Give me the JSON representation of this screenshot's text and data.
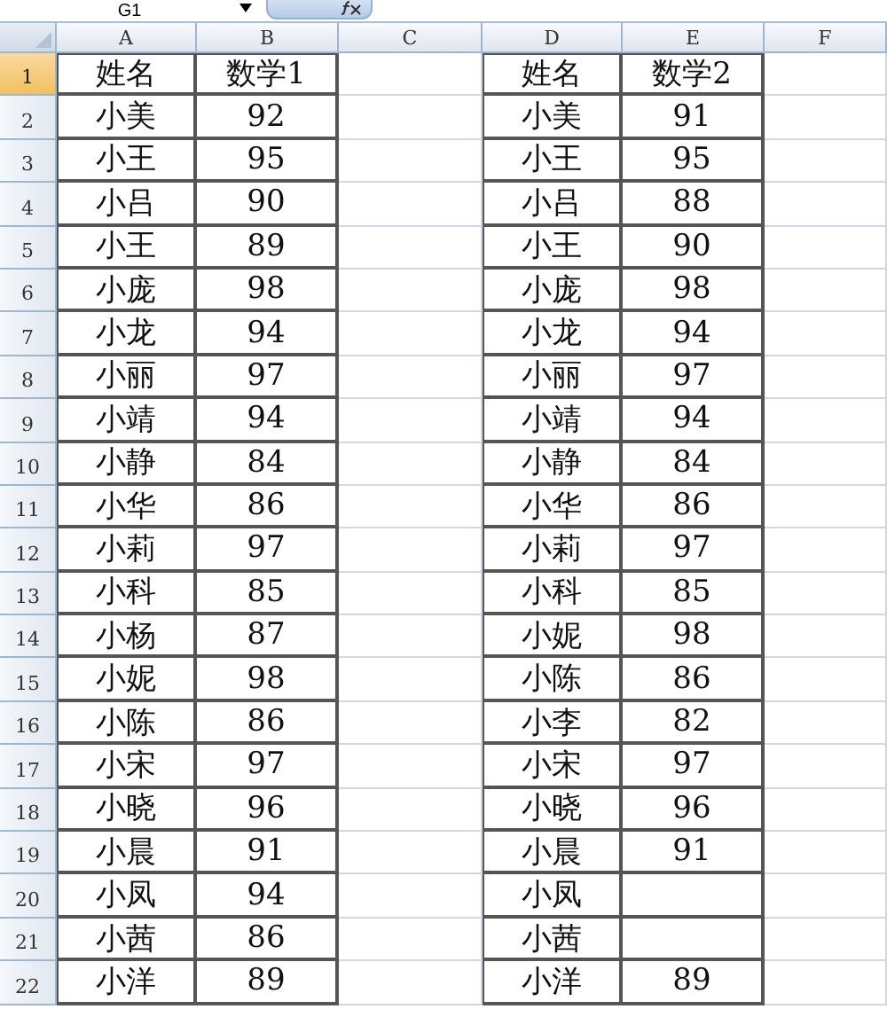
{
  "name_box": "G1",
  "columns": [
    "A",
    "B",
    "C",
    "D",
    "E",
    "F"
  ],
  "rows": [
    {
      "number": "1",
      "selected": true,
      "name_1": "姓名",
      "score_1": "数学1",
      "name_2": "姓名",
      "score_2": "数学2"
    },
    {
      "number": "2",
      "selected": false,
      "name_1": "小美",
      "score_1": "92",
      "name_2": "小美",
      "score_2": "91"
    },
    {
      "number": "3",
      "selected": false,
      "name_1": "小王",
      "score_1": "95",
      "name_2": "小王",
      "score_2": "95"
    },
    {
      "number": "4",
      "selected": false,
      "name_1": "小吕",
      "score_1": "90",
      "name_2": "小吕",
      "score_2": "88"
    },
    {
      "number": "5",
      "selected": false,
      "name_1": "小王",
      "score_1": "89",
      "name_2": "小王",
      "score_2": "90"
    },
    {
      "number": "6",
      "selected": false,
      "name_1": "小庞",
      "score_1": "98",
      "name_2": "小庞",
      "score_2": "98"
    },
    {
      "number": "7",
      "selected": false,
      "name_1": "小龙",
      "score_1": "94",
      "name_2": "小龙",
      "score_2": "94"
    },
    {
      "number": "8",
      "selected": false,
      "name_1": "小丽",
      "score_1": "97",
      "name_2": "小丽",
      "score_2": "97"
    },
    {
      "number": "9",
      "selected": false,
      "name_1": "小靖",
      "score_1": "94",
      "name_2": "小靖",
      "score_2": "94"
    },
    {
      "number": "10",
      "selected": false,
      "name_1": "小静",
      "score_1": "84",
      "name_2": "小静",
      "score_2": "84"
    },
    {
      "number": "11",
      "selected": false,
      "name_1": "小华",
      "score_1": "86",
      "name_2": "小华",
      "score_2": "86"
    },
    {
      "number": "12",
      "selected": false,
      "name_1": "小莉",
      "score_1": "97",
      "name_2": "小莉",
      "score_2": "97"
    },
    {
      "number": "13",
      "selected": false,
      "name_1": "小科",
      "score_1": "85",
      "name_2": "小科",
      "score_2": "85"
    },
    {
      "number": "14",
      "selected": false,
      "name_1": "小杨",
      "score_1": "87",
      "name_2": "小妮",
      "score_2": "98"
    },
    {
      "number": "15",
      "selected": false,
      "name_1": "小妮",
      "score_1": "98",
      "name_2": "小陈",
      "score_2": "86"
    },
    {
      "number": "16",
      "selected": false,
      "name_1": "小陈",
      "score_1": "86",
      "name_2": "小李",
      "score_2": "82"
    },
    {
      "number": "17",
      "selected": false,
      "name_1": "小宋",
      "score_1": "97",
      "name_2": "小宋",
      "score_2": "97"
    },
    {
      "number": "18",
      "selected": false,
      "name_1": "小晓",
      "score_1": "96",
      "name_2": "小晓",
      "score_2": "96"
    },
    {
      "number": "19",
      "selected": false,
      "name_1": "小晨",
      "score_1": "91",
      "name_2": "小晨",
      "score_2": "91"
    },
    {
      "number": "20",
      "selected": false,
      "name_1": "小凤",
      "score_1": "94",
      "name_2": "小凤"
    },
    {
      "number": "21",
      "selected": false,
      "name_1": "小茜",
      "score_1": "86",
      "name_2": "小茜"
    },
    {
      "number": "22",
      "selected": false,
      "name_1": "小洋",
      "score_1": "89",
      "name_2": "小洋",
      "score_2": "89"
    }
  ]
}
